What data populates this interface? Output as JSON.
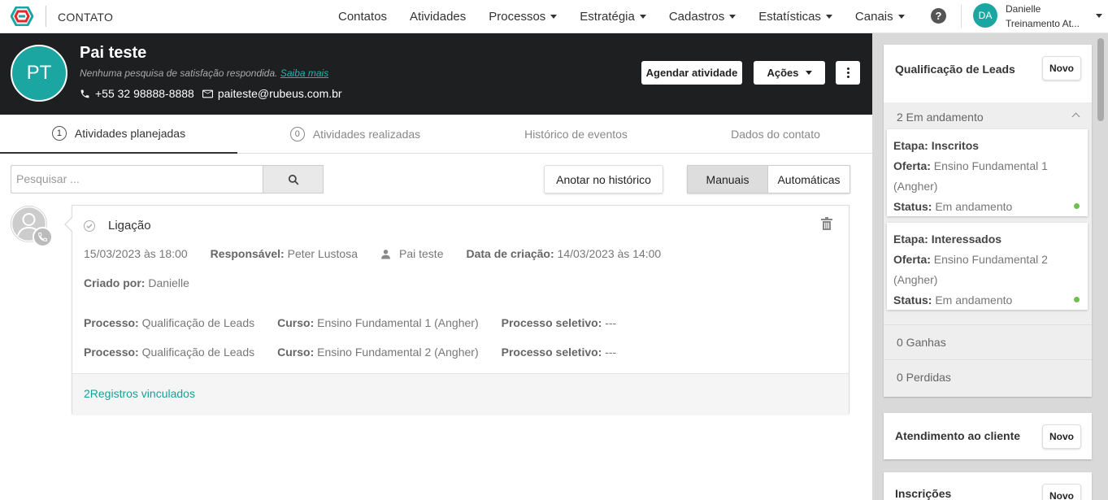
{
  "topnav": {
    "page_label": "CONTATO",
    "menu": [
      {
        "label": "Contatos",
        "dropdown": false
      },
      {
        "label": "Atividades",
        "dropdown": false
      },
      {
        "label": "Processos",
        "dropdown": true
      },
      {
        "label": "Estratégia",
        "dropdown": true
      },
      {
        "label": "Cadastros",
        "dropdown": true
      },
      {
        "label": "Estatísticas",
        "dropdown": true
      },
      {
        "label": "Canais",
        "dropdown": true
      }
    ],
    "help_label": "?",
    "user": {
      "initials": "DA",
      "name": "Danielle",
      "subtitle": "Treinamento At..."
    }
  },
  "contact": {
    "initials": "PT",
    "name": "Pai teste",
    "survey_text": "Nenhuma pesquisa de satisfação respondida.",
    "survey_link": "Saiba mais",
    "phone": "+55 32 98888-8888",
    "email": "paiteste@rubeus.com.br",
    "schedule_button": "Agendar atividade",
    "actions_button": "Ações"
  },
  "tabs": [
    {
      "label": "Atividades planejadas",
      "count": "1",
      "active": true
    },
    {
      "label": "Atividades realizadas",
      "count": "0",
      "active": false
    },
    {
      "label": "Histórico de eventos",
      "count": "",
      "active": false
    },
    {
      "label": "Dados do contato",
      "count": "",
      "active": false
    }
  ],
  "toolbar": {
    "search_placeholder": "Pesquisar ...",
    "annotate_button": "Anotar no histórico",
    "toggle_manual": "Manuais",
    "toggle_auto": "Automáticas"
  },
  "activity": {
    "type": "Ligação",
    "datetime": "15/03/2023 às 18:00",
    "responsible_label": "Responsável:",
    "responsible": "Peter Lustosa",
    "contact": "Pai teste",
    "created_label": "Data de criação:",
    "created": "14/03/2023 às 14:00",
    "creator_label": "Criado por:",
    "creator": "Danielle",
    "records": [
      {
        "process_label": "Processo:",
        "process": "Qualificação de Leads",
        "course_label": "Curso:",
        "course": "Ensino Fundamental 1 (Angher)",
        "selective_label": "Processo seletivo:",
        "selective": "---"
      },
      {
        "process_label": "Processo:",
        "process": "Qualificação de Leads",
        "course_label": "Curso:",
        "course": "Ensino Fundamental 2 (Angher)",
        "selective_label": "Processo seletivo:",
        "selective": "---"
      }
    ],
    "footer_link": "2Registros vinculados"
  },
  "panel": {
    "cards": [
      {
        "title": "Qualificação de Leads",
        "new_button": "Novo",
        "in_progress": "2 Em andamento",
        "stages": [
          {
            "stage_label": "Etapa:",
            "stage": "Inscritos",
            "offer_label": "Oferta:",
            "offer": "Ensino Fundamental 1 (Angher)",
            "status_label": "Status:",
            "status": "Em andamento"
          },
          {
            "stage_label": "Etapa:",
            "stage": "Interessados",
            "offer_label": "Oferta:",
            "offer": "Ensino Fundamental 2 (Angher)",
            "status_label": "Status:",
            "status": "Em andamento"
          }
        ],
        "won": "0 Ganhas",
        "lost": "0 Perdidas"
      },
      {
        "title": "Atendimento ao cliente",
        "new_button": "Novo"
      },
      {
        "title": "Inscrições",
        "new_button": "Novo"
      }
    ]
  },
  "colors": {
    "brand": "#1ba6a1",
    "header_bg": "#1d1f20",
    "status_dot": "#6cc24a"
  }
}
